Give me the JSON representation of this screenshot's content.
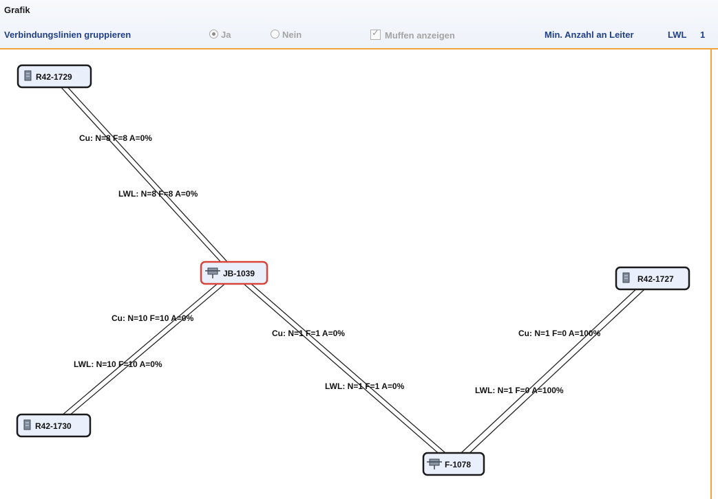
{
  "panel": {
    "title": "Grafik"
  },
  "toolbar": {
    "group_label": "Verbindungslinien gruppieren",
    "radio_ja": "Ja",
    "radio_nein": "Nein",
    "muffen_label": "Muffen anzeigen",
    "min_label": "Min. Anzahl an Leiter",
    "lwl_label": "LWL",
    "lwl_value": "1"
  },
  "nodes": [
    {
      "id": "n1",
      "label": "R42-1729",
      "type": "rack",
      "selected": false
    },
    {
      "id": "n2",
      "label": "JB-1039",
      "type": "junction",
      "selected": true
    },
    {
      "id": "n3",
      "label": "R42-1730",
      "type": "rack",
      "selected": false
    },
    {
      "id": "n4",
      "label": "F-1078",
      "type": "junction",
      "selected": false
    },
    {
      "id": "n5",
      "label": "R42-1727",
      "type": "rack",
      "selected": false
    }
  ],
  "edge_labels": [
    {
      "id": "e1cu",
      "text": "Cu: N=8 F=8 A=0%"
    },
    {
      "id": "e1lwl",
      "text": "LWL: N=8 F=8 A=0%"
    },
    {
      "id": "e2cu",
      "text": "Cu: N=10 F=10 A=0%"
    },
    {
      "id": "e2lwl",
      "text": "LWL: N=10 F=10 A=0%"
    },
    {
      "id": "e3cu",
      "text": "Cu: N=1 F=1 A=0%"
    },
    {
      "id": "e3lwl",
      "text": "LWL: N=1 F=1 A=0%"
    },
    {
      "id": "e4cu",
      "text": "Cu: N=1 F=0 A=100%"
    },
    {
      "id": "e4lwl",
      "text": "LWL: N=1 F=0 A=100%"
    }
  ]
}
